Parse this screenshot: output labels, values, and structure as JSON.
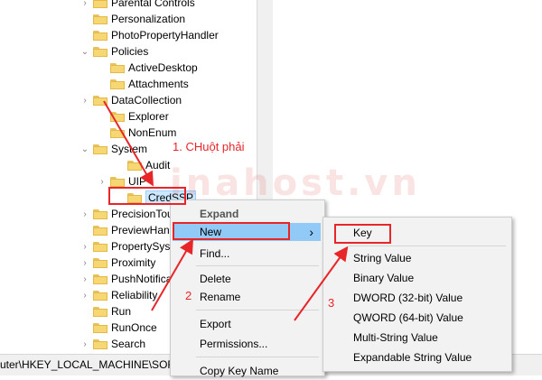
{
  "tree": {
    "items": [
      {
        "label": "Parental Controls",
        "arrow": ">",
        "selected": false
      },
      {
        "label": "Personalization",
        "arrow": "",
        "selected": false
      },
      {
        "label": "PhotoPropertyHandler",
        "arrow": "",
        "selected": false
      },
      {
        "label": "Policies",
        "arrow": "v",
        "selected": false
      },
      {
        "label": "ActiveDesktop",
        "arrow": "",
        "selected": false
      },
      {
        "label": "Attachments",
        "arrow": "",
        "selected": false
      },
      {
        "label": "DataCollection",
        "arrow": ">",
        "selected": false
      },
      {
        "label": "Explorer",
        "arrow": "",
        "selected": false
      },
      {
        "label": "NonEnum",
        "arrow": "",
        "selected": false
      },
      {
        "label": "System",
        "arrow": "v",
        "selected": false
      },
      {
        "label": "Audit",
        "arrow": "",
        "selected": false
      },
      {
        "label": "UIP",
        "arrow": ">",
        "selected": false
      },
      {
        "label": "CredSSP",
        "arrow": "",
        "selected": true
      },
      {
        "label": "PrecisionTou",
        "arrow": ">",
        "selected": false
      },
      {
        "label": "PreviewHand",
        "arrow": "",
        "selected": false
      },
      {
        "label": "PropertySyst",
        "arrow": ">",
        "selected": false
      },
      {
        "label": "Proximity",
        "arrow": ">",
        "selected": false
      },
      {
        "label": "PushNotifica",
        "arrow": ">",
        "selected": false
      },
      {
        "label": "Reliability",
        "arrow": ">",
        "selected": false
      },
      {
        "label": "Run",
        "arrow": "",
        "selected": false
      },
      {
        "label": "RunOnce",
        "arrow": "",
        "selected": false
      },
      {
        "label": "Search",
        "arrow": ">",
        "selected": false
      }
    ]
  },
  "status_bar": {
    "path": "uter\\HKEY_LOCAL_MACHINE\\SOFT"
  },
  "context_menu": {
    "items": [
      {
        "label": "Expand",
        "bold": true,
        "highlighted": false,
        "submenu": false
      },
      {
        "label": "New",
        "bold": false,
        "highlighted": true,
        "submenu": true
      },
      {
        "label": "Find...",
        "bold": false,
        "highlighted": false,
        "submenu": false
      },
      {
        "label": "Delete",
        "bold": false,
        "highlighted": false,
        "submenu": false
      },
      {
        "label": "Rename",
        "bold": false,
        "highlighted": false,
        "submenu": false
      },
      {
        "label": "Export",
        "bold": false,
        "highlighted": false,
        "submenu": false
      },
      {
        "label": "Permissions...",
        "bold": false,
        "highlighted": false,
        "submenu": false
      },
      {
        "label": "Copy Key Name",
        "bold": false,
        "highlighted": false,
        "submenu": false
      }
    ]
  },
  "submenu": {
    "items": [
      {
        "label": "Key"
      },
      {
        "label": "String Value"
      },
      {
        "label": "Binary Value"
      },
      {
        "label": "DWORD (32-bit) Value"
      },
      {
        "label": "QWORD (64-bit) Value"
      },
      {
        "label": "Multi-String Value"
      },
      {
        "label": "Expandable String Value"
      }
    ]
  },
  "annotations": {
    "step1": "1. CHuột phải",
    "step2": "2",
    "step3": "3",
    "color": "#e8262a"
  },
  "watermark": "inahost.vn",
  "colors": {
    "menu_highlight": "#91c9f7",
    "selection": "#cce8ff",
    "folder": "#f7d774"
  }
}
